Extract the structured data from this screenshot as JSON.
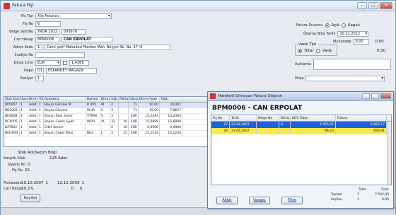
{
  "window": {
    "title": "Fatura Fişi"
  },
  "form": {
    "fis_tipi_label": "Fiş Tipi",
    "fis_tipi_value": "Alış Faturası",
    "fis_no_label": "Fiş No",
    "fis_no_value": "6",
    "belge_no_label": "Belge Seri/No",
    "belge_seri": "TRDR 2012",
    "belge_no": "000678",
    "cari_hesap_label": "Cari Hesap",
    "cari_kod": "BPM0006",
    "cari_ad": "CAN ERPOLAT",
    "adres_label": "Adres Kodu",
    "adres_kod": "1",
    "adres_value": "Cami şerif Mahallesi Merkez Mah. Beşyol Sk. No: 37 /4",
    "irsaliye_label": "İrsaliye No",
    "doviz_label": "Döviz Cinsi",
    "doviz_value": "EUR",
    "kur_value": "1,4368",
    "depo_label": "Depo",
    "depo_kod": "D1",
    "depo_ad": "ESKANDEY MAĞAZA",
    "kasa_label": "Kasiyer",
    "kasa_value": "1",
    "fatura_durumu_label": "Fatura Durumu",
    "opt_acik": "Açık",
    "opt_kapali": "Kapalı",
    "odeme_tarih_label": "Ödeme Bitiş Tarihi",
    "odeme_tarih_value": "10.11.2012",
    "muhasebe_label": "Muhasebe",
    "muhasebe_value": "6,00",
    "muhasebe_value2": "0,00",
    "vade_label": "Vade Tipi",
    "opt_tutar": "Tutar",
    "opt_vade": "Vade",
    "aciklama_label": "Açıklama",
    "proje_label": "Proje"
  },
  "grid": {
    "headers": [
      "Stok Kodu",
      "Doviz",
      "Birim",
      "Tür",
      "Açıklama",
      "Barkod",
      "Birim",
      "Sab.",
      "Miktar",
      "Döviz",
      "Birim Fiyatı",
      "Tutar"
    ],
    "rows": [
      [
        "005007",
        "1",
        "Adet",
        "1",
        "Beyaz Gömlek M",
        "R 405",
        "M",
        "2",
        "",
        "TL",
        "10,00",
        "20,007"
      ],
      [
        "BB1008",
        "1",
        "Adet",
        "1",
        "Beyaz Gömlek",
        "WHR",
        "S",
        "3",
        "",
        "TL",
        "15,00",
        "7,8657"
      ],
      [
        "BE4008",
        "1",
        "Adet",
        "1",
        "Bayan Etek Suner",
        "STRAK",
        "S",
        "3",
        "",
        "EUR",
        "14,2493",
        "14,2493"
      ],
      [
        "BCX005",
        "1",
        "Adet",
        "1",
        "Bayan Ceket Siyah",
        "WOR",
        "XL",
        "32",
        "20",
        "EUR",
        "15,6899",
        "15,6899"
      ],
      [
        "BAT002",
        "1",
        "Adet",
        "1",
        "Etkili Kemer",
        "",
        "",
        "2",
        "10",
        "EUR",
        "0,4966",
        "0,4966"
      ],
      [
        "BCH009",
        "1",
        "Adet",
        "1",
        "Bayan Ceket Mavi",
        "BHL",
        "L",
        "3",
        "15",
        "EUR",
        "15,1234",
        "15,1234"
      ]
    ]
  },
  "summary": {
    "stok_label": "Stok Adı/Seçim Bilgi",
    "karsilik_label": "Karşılık Stok",
    "karsilik_value": "125 Adet",
    "siparis_label": "Sipariş No",
    "siparis_value": "0",
    "fis_label": "Fiş No",
    "fis_value": "20",
    "muhasebe_label": "Muhasebe",
    "muhasebe_date": "10.10.2007",
    "muhasebe_no": "1",
    "muhasebe_date2": "12.10.2009",
    "muhasebe_no2": "1",
    "cari_hesap_label": "Cari Hesap",
    "cari_hesap_value": "10,2%",
    "cari_hesap_value2": "0",
    "cari_hesap_value3": "0",
    "save_label": "Kaydet"
  },
  "dialog": {
    "title": "Hareketi Olmayan Fatura Olayları",
    "header": "BPM0006 - CAN ERPOLAT",
    "headers": [
      "Fiş No",
      "Tarih",
      "Belge No",
      "Döviz",
      "KDV Tutarı",
      "Fatura"
    ],
    "rows": [
      {
        "cells": [
          "27",
          "22.04.2007",
          "",
          "D",
          "1.045,07",
          "6.856,17"
        ],
        "style": "blue"
      },
      {
        "cells": [
          "28",
          "23.04.2007",
          "",
          "",
          "96,23",
          "695,91"
        ],
        "style": "yellow"
      }
    ],
    "btn_aktar": "Aktar",
    "btn_iptal": "Vazgeç",
    "btn_filtre": "Filtre",
    "footer_cols": [
      "Tutar",
      "Tutar"
    ],
    "footer_rows": [
      {
        "label": "Toplam",
        "n": "1",
        "v": "7.542,08"
      },
      {
        "label": "Seçilen",
        "n": "1",
        "v": "0,00"
      }
    ]
  }
}
